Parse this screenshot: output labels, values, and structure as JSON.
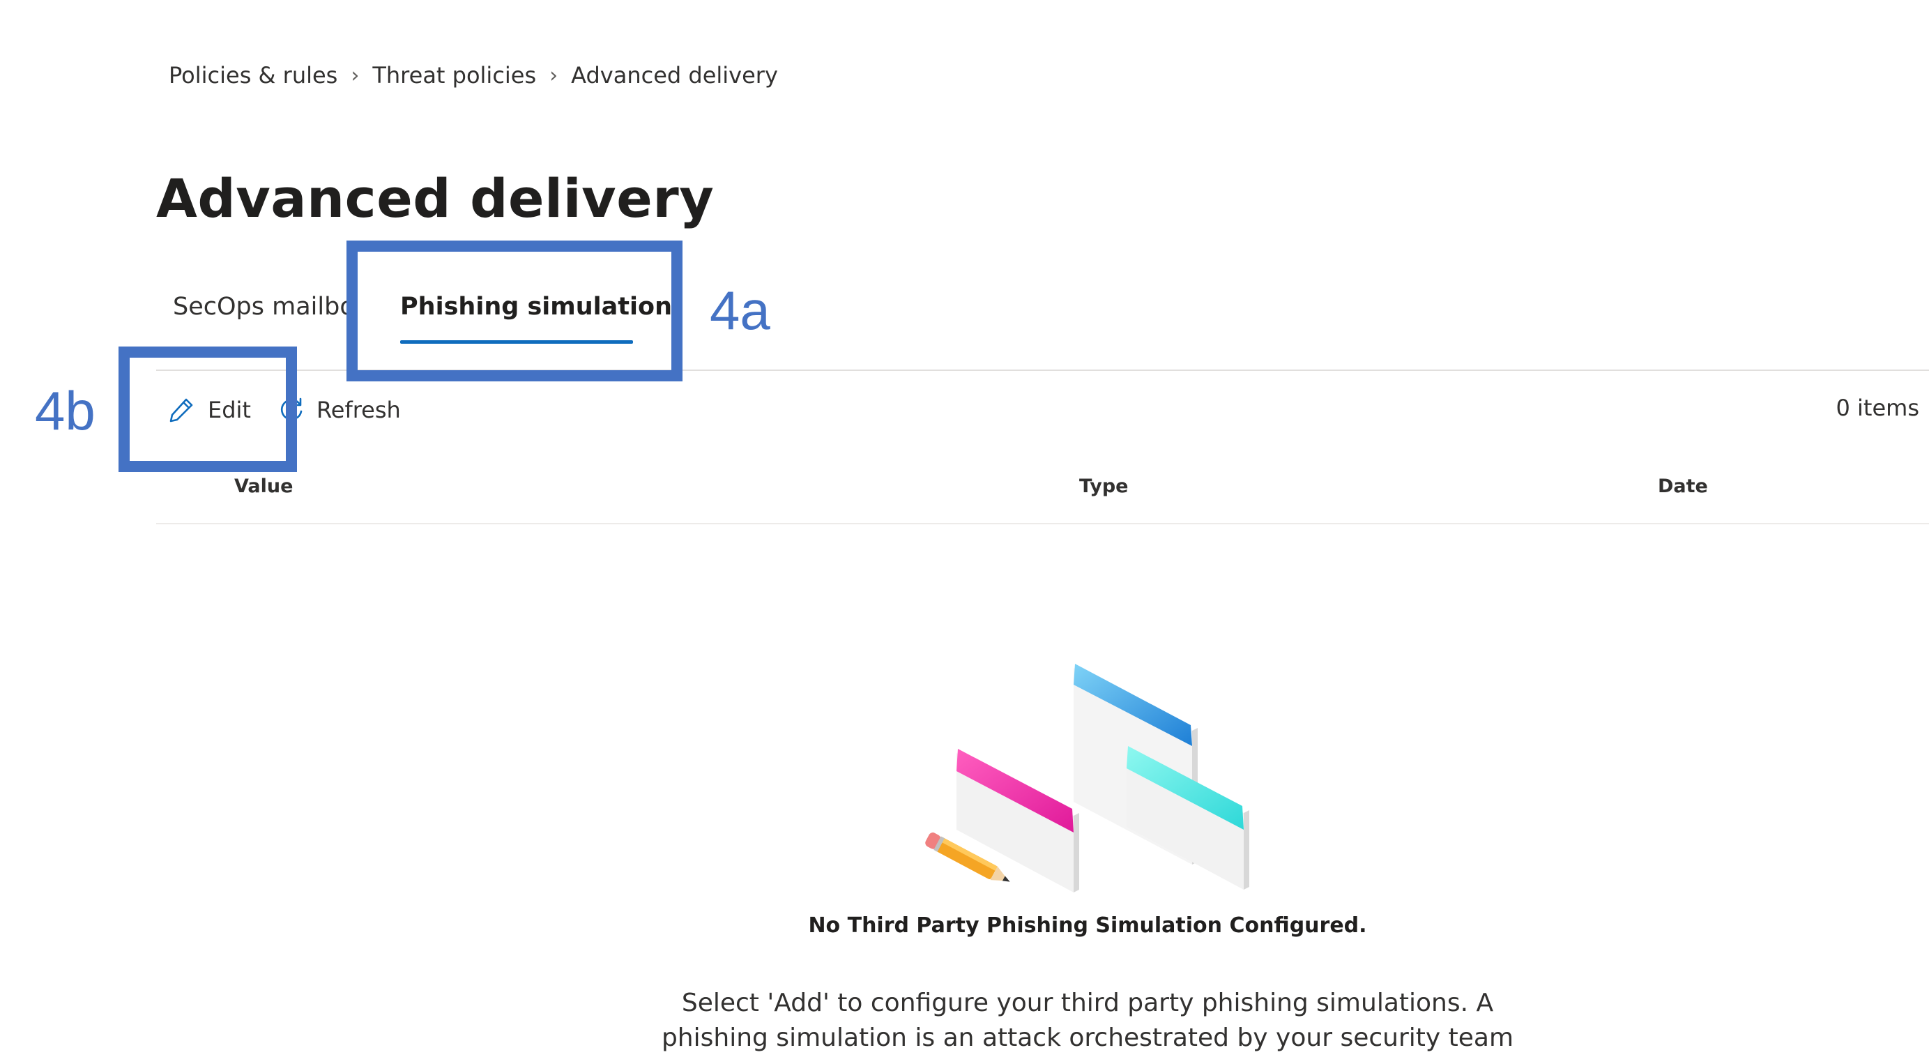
{
  "breadcrumb": {
    "items": [
      "Policies & rules",
      "Threat policies",
      "Advanced delivery"
    ]
  },
  "page": {
    "title": "Advanced delivery"
  },
  "tabs": [
    {
      "label": "SecOps mailbox",
      "active": false
    },
    {
      "label": "Phishing simulation",
      "active": true
    }
  ],
  "toolbar": {
    "edit_label": "Edit",
    "edit_icon": "pencil-icon",
    "refresh_label": "Refresh",
    "refresh_icon": "refresh-icon",
    "item_count": "0 items"
  },
  "table": {
    "columns": [
      "Value",
      "Type",
      "Date"
    ],
    "rows": []
  },
  "empty_state": {
    "title": "No Third Party Phishing Simulation Configured.",
    "description": "Select 'Add' to configure your third party phishing simulations. A phishing simulation is an attack orchestrated by your security team that is used for"
  },
  "annotations": {
    "tab_callout": "4a",
    "toolbar_callout": "4b",
    "color": "#4472c4"
  },
  "colors": {
    "accent": "#0f6cbd",
    "text": "#323130",
    "divider": "#e1dfdd"
  }
}
